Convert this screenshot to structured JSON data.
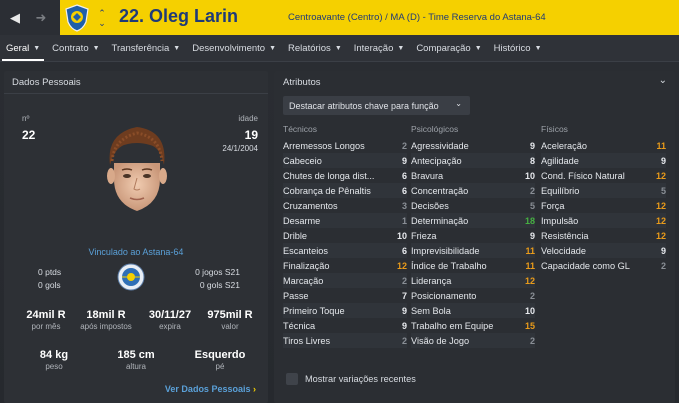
{
  "header": {
    "player_name": "22. Oleg Larin",
    "subtitle": "Centroavante (Centro) / MA (D) - Time Reserva do Astana-64",
    "back_icon": "arrow-left-icon",
    "forward_icon": "arrow-right-icon",
    "accent": "#f5d000"
  },
  "tabs": [
    {
      "label": "Geral",
      "active": true
    },
    {
      "label": "Contrato"
    },
    {
      "label": "Transferência"
    },
    {
      "label": "Desenvolvimento"
    },
    {
      "label": "Relatórios"
    },
    {
      "label": "Interação"
    },
    {
      "label": "Comparação"
    },
    {
      "label": "Histórico"
    }
  ],
  "personal": {
    "title": "Dados Pessoais",
    "number_label": "nº",
    "number": "22",
    "age_label": "idade",
    "age": "19",
    "dob": "24/1/2004",
    "contract_link": "Vinculado ao Astana-64",
    "pts": "0 ptds",
    "goals": "0 gols",
    "games_s21": "0 jogos S21",
    "goals_s21": "0 gols S21",
    "finance": [
      {
        "value": "24mil R",
        "label": "por mês"
      },
      {
        "value": "18mil R",
        "label": "após impostos"
      },
      {
        "value": "30/11/27",
        "label": "expira"
      },
      {
        "value": "975mil R",
        "label": "valor"
      }
    ],
    "physical": [
      {
        "value": "84 kg",
        "label": "peso"
      },
      {
        "value": "185 cm",
        "label": "altura"
      },
      {
        "value": "Esquerdo",
        "label": "pé"
      }
    ],
    "more_link": "Ver Dados Pessoais"
  },
  "attributes": {
    "title": "Atributos",
    "dropdown": "Destacar atributos chave para função",
    "columns": [
      {
        "head": "Técnicos",
        "rows": [
          {
            "name": "Arremessos Longos",
            "value": "2"
          },
          {
            "name": "Cabeceio",
            "value": "9"
          },
          {
            "name": "Chutes de longa dist...",
            "value": "6"
          },
          {
            "name": "Cobrança de Pênaltis",
            "value": "6"
          },
          {
            "name": "Cruzamentos",
            "value": "3"
          },
          {
            "name": "Desarme",
            "value": "1"
          },
          {
            "name": "Drible",
            "value": "10"
          },
          {
            "name": "Escanteios",
            "value": "6"
          },
          {
            "name": "Finalização",
            "value": "12"
          },
          {
            "name": "Marcação",
            "value": "2"
          },
          {
            "name": "Passe",
            "value": "7"
          },
          {
            "name": "Primeiro Toque",
            "value": "9"
          },
          {
            "name": "Técnica",
            "value": "9"
          },
          {
            "name": "Tiros Livres",
            "value": "2"
          }
        ]
      },
      {
        "head": "Psicológicos",
        "rows": [
          {
            "name": "Agressividade",
            "value": "9"
          },
          {
            "name": "Antecipação",
            "value": "8"
          },
          {
            "name": "Bravura",
            "value": "10"
          },
          {
            "name": "Concentração",
            "value": "2"
          },
          {
            "name": "Decisões",
            "value": "5"
          },
          {
            "name": "Determinação",
            "value": "18"
          },
          {
            "name": "Frieza",
            "value": "9"
          },
          {
            "name": "Imprevisibilidade",
            "value": "11"
          },
          {
            "name": "Índice de Trabalho",
            "value": "11"
          },
          {
            "name": "Liderança",
            "value": "12"
          },
          {
            "name": "Posicionamento",
            "value": "2"
          },
          {
            "name": "Sem Bola",
            "value": "10"
          },
          {
            "name": "Trabalho em Equipe",
            "value": "15"
          },
          {
            "name": "Visão de Jogo",
            "value": "2"
          }
        ]
      },
      {
        "head": "Físicos",
        "rows": [
          {
            "name": "Aceleração",
            "value": "11"
          },
          {
            "name": "Agilidade",
            "value": "9"
          },
          {
            "name": "Cond. Físico Natural",
            "value": "12"
          },
          {
            "name": "Equilíbrio",
            "value": "5"
          },
          {
            "name": "Força",
            "value": "12"
          },
          {
            "name": "Impulsão",
            "value": "12"
          },
          {
            "name": "Resistência",
            "value": "12"
          },
          {
            "name": "Velocidade",
            "value": "9"
          },
          {
            "name": "Capacidade como GL",
            "value": "2"
          }
        ]
      }
    ],
    "checkbox_label": "Mostrar variações recentes"
  }
}
